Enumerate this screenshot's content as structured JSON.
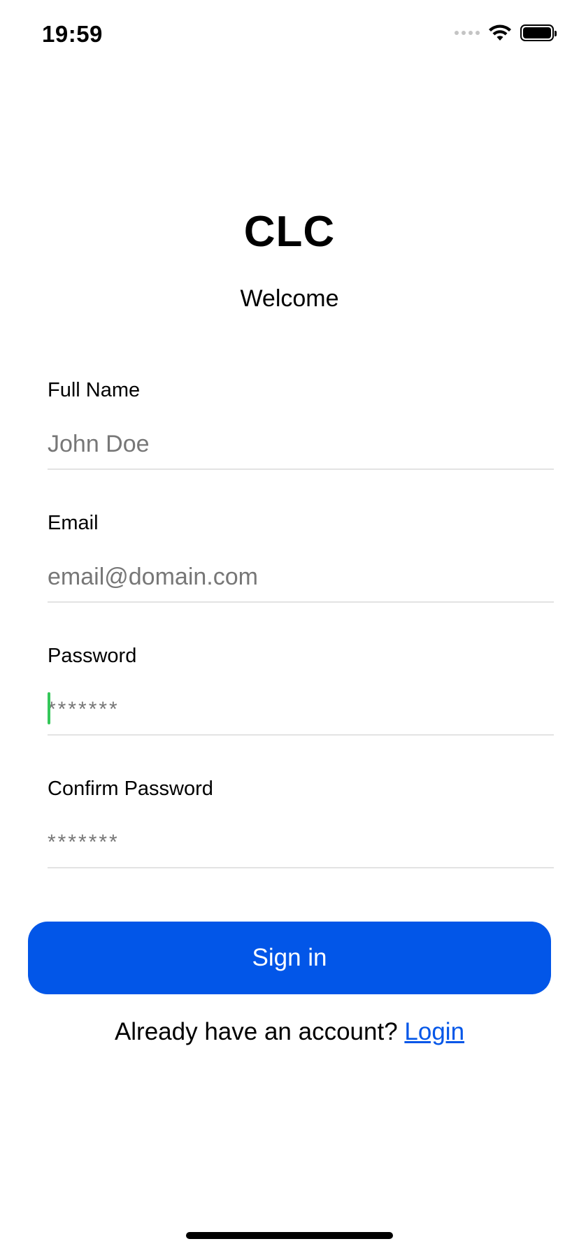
{
  "status_bar": {
    "time": "19:59",
    "icons": [
      "signal-icon",
      "wifi-icon",
      "battery-icon"
    ]
  },
  "header": {
    "title": "CLC",
    "subtitle": "Welcome"
  },
  "form": {
    "full_name": {
      "label": "Full Name",
      "placeholder": "John Doe",
      "value": ""
    },
    "email": {
      "label": "Email",
      "placeholder": "email@domain.com",
      "value": ""
    },
    "password": {
      "label": "Password",
      "placeholder": "*******",
      "value": "",
      "focused": true
    },
    "confirm_password": {
      "label": "Confirm Password",
      "placeholder": "*******",
      "value": ""
    }
  },
  "actions": {
    "signin_label": "Sign in",
    "account_prompt": "Already have an account?",
    "login_label": "Login"
  },
  "colors": {
    "accent": "#0256e8",
    "cursor": "#34c759",
    "placeholder": "#777777",
    "divider": "#e3e3e3"
  }
}
